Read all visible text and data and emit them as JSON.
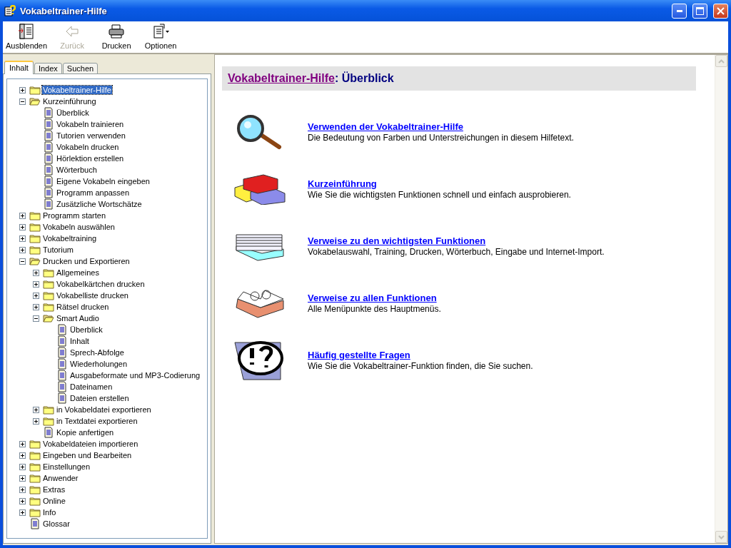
{
  "window": {
    "title": "Vokabeltrainer-Hilfe"
  },
  "toolbar": [
    {
      "label": "Ausblenden",
      "disabled": false
    },
    {
      "label": "Zurück",
      "disabled": true
    },
    {
      "label": "Drucken",
      "disabled": false
    },
    {
      "label": "Optionen",
      "disabled": false
    }
  ],
  "tabs": [
    {
      "label": "Inhalt",
      "selected": true
    },
    {
      "label": "Index",
      "selected": false
    },
    {
      "label": "Suchen",
      "selected": false
    }
  ],
  "tree": [
    {
      "label": "Vokabeltrainer-Hilfe",
      "kind": "folder",
      "expanded": false,
      "selected": true
    },
    {
      "label": "Kurzeinführung",
      "kind": "folder",
      "expanded": true,
      "selected": false,
      "children": [
        {
          "label": "Überblick",
          "kind": "page",
          "selected": false
        },
        {
          "label": "Vokabeln trainieren",
          "kind": "page",
          "selected": false
        },
        {
          "label": "Tutorien verwenden",
          "kind": "page",
          "selected": false
        },
        {
          "label": "Vokabeln drucken",
          "kind": "page",
          "selected": false
        },
        {
          "label": "Hörlektion erstellen",
          "kind": "page",
          "selected": false
        },
        {
          "label": "Wörterbuch",
          "kind": "page",
          "selected": false
        },
        {
          "label": "Eigene Vokabeln eingeben",
          "kind": "page",
          "selected": false
        },
        {
          "label": "Programm anpassen",
          "kind": "page",
          "selected": false
        },
        {
          "label": "Zusätzliche Wortschätze",
          "kind": "page",
          "selected": false
        }
      ]
    },
    {
      "label": "Programm starten",
      "kind": "folder",
      "expanded": false,
      "selected": false
    },
    {
      "label": "Vokabeln auswählen",
      "kind": "folder",
      "expanded": false,
      "selected": false
    },
    {
      "label": "Vokabeltraining",
      "kind": "folder",
      "expanded": false,
      "selected": false
    },
    {
      "label": "Tutorium",
      "kind": "folder",
      "expanded": false,
      "selected": false
    },
    {
      "label": "Drucken und Exportieren",
      "kind": "folder",
      "expanded": true,
      "selected": false,
      "children": [
        {
          "label": "Allgemeines",
          "kind": "folder",
          "expanded": false,
          "selected": false
        },
        {
          "label": "Vokabelkärtchen drucken",
          "kind": "folder",
          "expanded": false,
          "selected": false
        },
        {
          "label": "Vokabelliste drucken",
          "kind": "folder",
          "expanded": false,
          "selected": false
        },
        {
          "label": "Rätsel drucken",
          "kind": "folder",
          "expanded": false,
          "selected": false
        },
        {
          "label": "Smart Audio",
          "kind": "folder",
          "expanded": true,
          "selected": false,
          "children": [
            {
              "label": "Überblick",
              "kind": "page",
              "selected": false
            },
            {
              "label": "Inhalt",
              "kind": "page",
              "selected": false
            },
            {
              "label": "Sprech-Abfolge",
              "kind": "page",
              "selected": false
            },
            {
              "label": "Wiederholungen",
              "kind": "page",
              "selected": false
            },
            {
              "label": "Ausgabeformate und MP3-Codierung",
              "kind": "page",
              "selected": false
            },
            {
              "label": "Dateinamen",
              "kind": "page",
              "selected": false
            },
            {
              "label": "Dateien erstellen",
              "kind": "page",
              "selected": false
            }
          ]
        },
        {
          "label": "in Vokabeldatei exportieren",
          "kind": "folder",
          "expanded": false,
          "selected": false
        },
        {
          "label": "in Textdatei exportieren",
          "kind": "folder",
          "expanded": false,
          "selected": false
        },
        {
          "label": "Kopie anfertigen",
          "kind": "page",
          "selected": false
        }
      ]
    },
    {
      "label": "Vokabeldateien importieren",
      "kind": "folder",
      "expanded": false,
      "selected": false
    },
    {
      "label": "Eingeben und Bearbeiten",
      "kind": "folder",
      "expanded": false,
      "selected": false
    },
    {
      "label": "Einstellungen",
      "kind": "folder",
      "expanded": false,
      "selected": false
    },
    {
      "label": "Anwender",
      "kind": "folder",
      "expanded": false,
      "selected": false
    },
    {
      "label": "Extras",
      "kind": "folder",
      "expanded": false,
      "selected": false
    },
    {
      "label": "Online",
      "kind": "folder",
      "expanded": false,
      "selected": false
    },
    {
      "label": "Info",
      "kind": "folder",
      "expanded": false,
      "selected": false
    },
    {
      "label": "Glossar",
      "kind": "page",
      "selected": false
    }
  ],
  "content": {
    "heading_link": "Vokabeltrainer-Hilfe",
    "heading_rest": ": Überblick",
    "entries": [
      {
        "title": "Verwenden der Vokabeltrainer-Hilfe",
        "description": "Die Bedeutung von Farben und Unterstreichungen in diesem Hilfetext."
      },
      {
        "title": "Kurzeinführung",
        "description": "Wie Sie die wichtigsten Funktionen schnell und einfach ausprobieren."
      },
      {
        "title": "Verweise zu den wichtigsten Funktionen",
        "description": "Vokabelauswahl, Training, Drucken, Wörterbuch, Eingabe und Internet-Import."
      },
      {
        "title": "Verweise zu allen Funktionen",
        "description": "Alle Menüpunkte des Hauptmenüs."
      },
      {
        "title": "Häufig gestellte Fragen",
        "description": "Wie Sie die Vokabeltrainer-Funktion finden, die Sie suchen."
      }
    ]
  }
}
